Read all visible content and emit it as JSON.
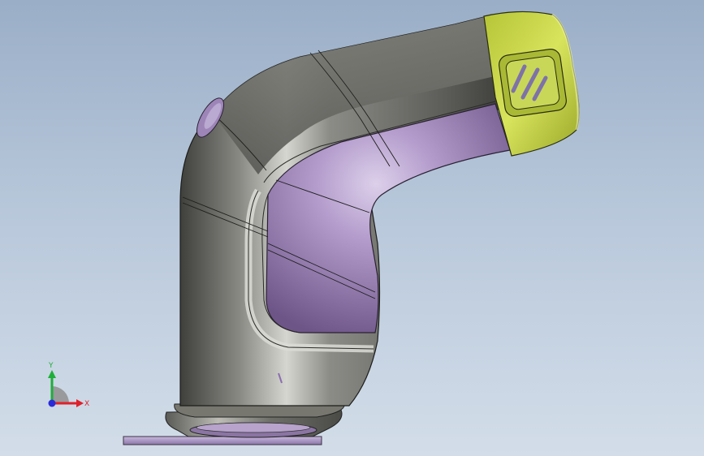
{
  "viewport": {
    "background_top": "#9aaec7",
    "background_bottom": "#d3dde9"
  },
  "model": {
    "body_color": "#6f6f6a",
    "grip_color": "#9c82b9",
    "head_color": "#c8d94a",
    "icon": "hatched-square-emblem"
  },
  "triad": {
    "y_label": "Y",
    "x_label": "X",
    "y_color": "#1fae3a",
    "x_color": "#e0202a",
    "z_color": "#2a2ad8"
  }
}
